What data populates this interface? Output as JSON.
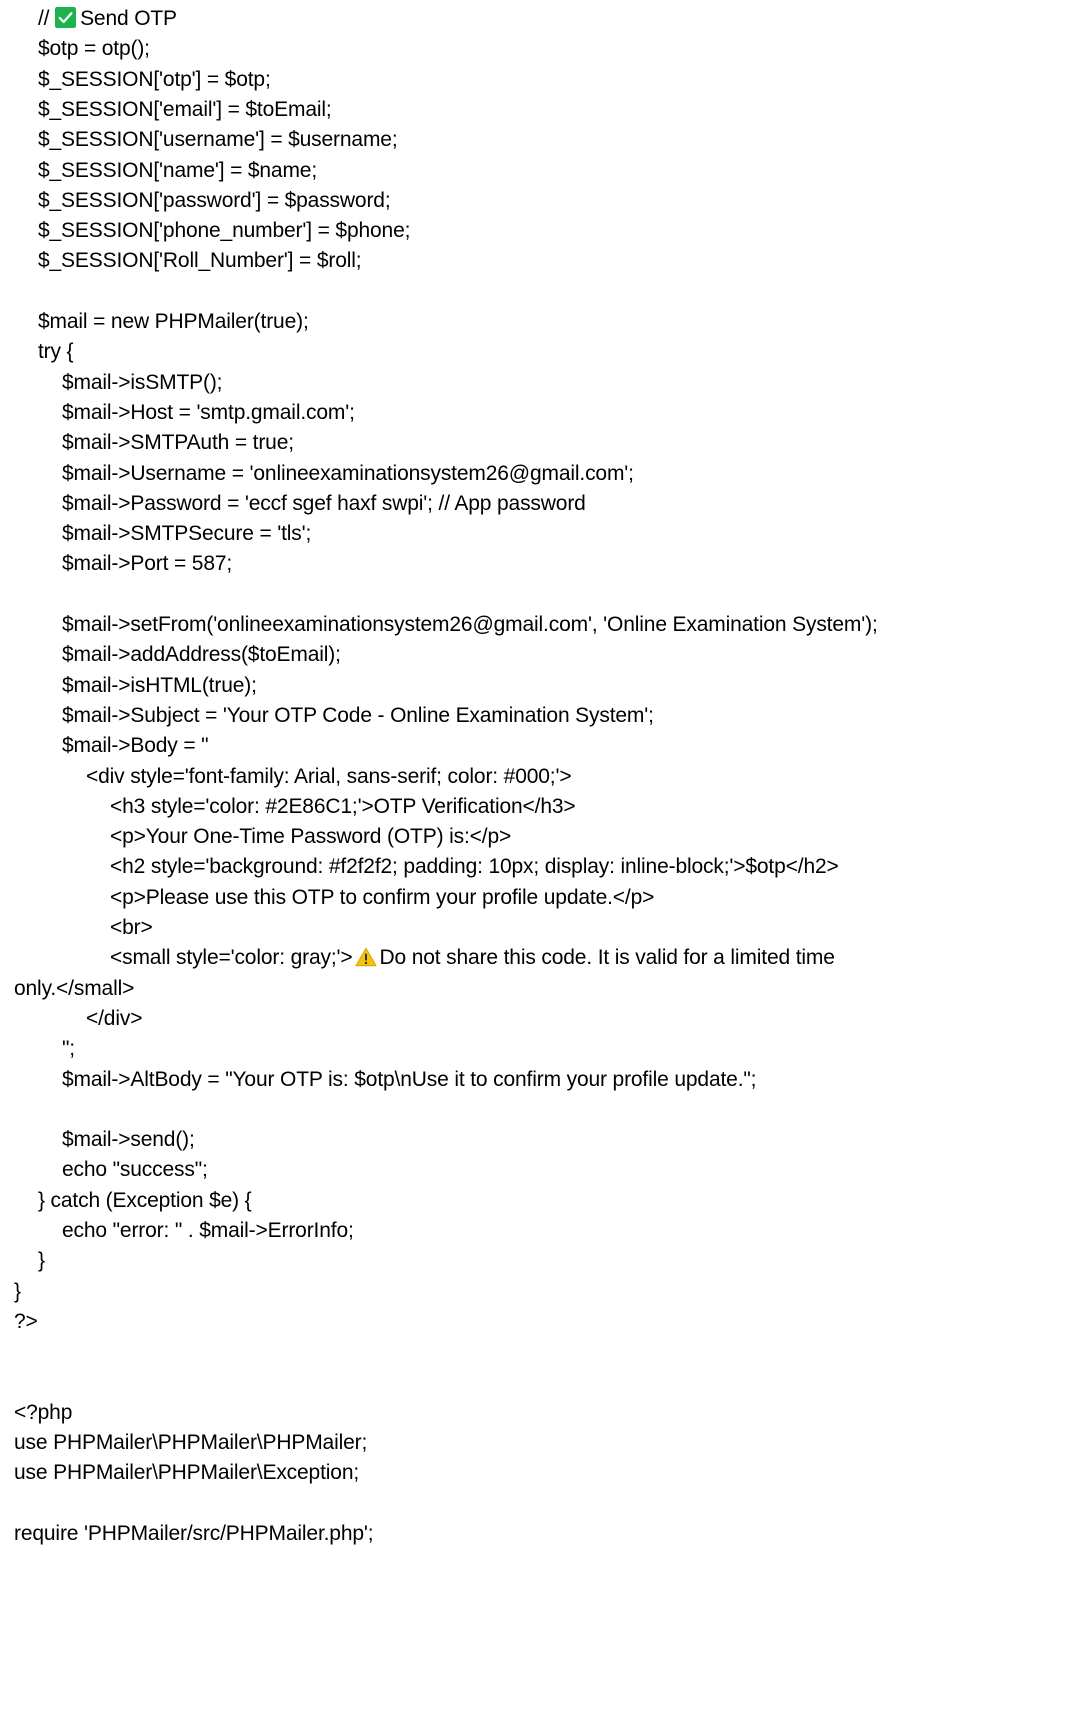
{
  "document": {
    "lines": [
      {
        "indent": 2,
        "segments": [
          {
            "t": "text",
            "v": "// "
          },
          {
            "t": "icon",
            "v": "check-icon"
          },
          {
            "t": "text",
            "v": "Send OTP"
          }
        ]
      },
      {
        "indent": 2,
        "segments": [
          {
            "t": "text",
            "v": "$otp = otp();"
          }
        ]
      },
      {
        "indent": 2,
        "segments": [
          {
            "t": "text",
            "v": "$_SESSION['otp'] = $otp;"
          }
        ]
      },
      {
        "indent": 2,
        "segments": [
          {
            "t": "text",
            "v": "$_SESSION['email'] = $toEmail;"
          }
        ]
      },
      {
        "indent": 2,
        "segments": [
          {
            "t": "text",
            "v": "$_SESSION['username'] = $username;"
          }
        ]
      },
      {
        "indent": 2,
        "segments": [
          {
            "t": "text",
            "v": "$_SESSION['name'] = $name;"
          }
        ]
      },
      {
        "indent": 2,
        "segments": [
          {
            "t": "text",
            "v": "$_SESSION['password'] = $password;"
          }
        ]
      },
      {
        "indent": 2,
        "segments": [
          {
            "t": "text",
            "v": "$_SESSION['phone_number'] = $phone;"
          }
        ]
      },
      {
        "indent": 2,
        "segments": [
          {
            "t": "text",
            "v": "$_SESSION['Roll_Number'] = $roll;"
          }
        ]
      },
      {
        "indent": 0,
        "segments": []
      },
      {
        "indent": 2,
        "segments": [
          {
            "t": "text",
            "v": "$mail = new PHPMailer(true);"
          }
        ]
      },
      {
        "indent": 2,
        "segments": [
          {
            "t": "text",
            "v": "try {"
          }
        ]
      },
      {
        "indent": 4,
        "segments": [
          {
            "t": "text",
            "v": "$mail->isSMTP();"
          }
        ]
      },
      {
        "indent": 4,
        "segments": [
          {
            "t": "text",
            "v": "$mail->Host = 'smtp.gmail.com';"
          }
        ]
      },
      {
        "indent": 4,
        "segments": [
          {
            "t": "text",
            "v": "$mail->SMTPAuth = true;"
          }
        ]
      },
      {
        "indent": 4,
        "segments": [
          {
            "t": "text",
            "v": "$mail->Username = 'onlineexaminationsystem26@gmail.com';"
          }
        ]
      },
      {
        "indent": 4,
        "segments": [
          {
            "t": "text",
            "v": "$mail->Password = 'eccf sgef haxf swpi'; // App password"
          }
        ]
      },
      {
        "indent": 4,
        "segments": [
          {
            "t": "text",
            "v": "$mail->SMTPSecure = 'tls';"
          }
        ]
      },
      {
        "indent": 4,
        "segments": [
          {
            "t": "text",
            "v": "$mail->Port = 587;"
          }
        ]
      },
      {
        "indent": 0,
        "segments": []
      },
      {
        "indent": 4,
        "segments": [
          {
            "t": "text",
            "v": "$mail->setFrom('onlineexaminationsystem26@gmail.com', 'Online Examination System');"
          }
        ]
      },
      {
        "indent": 4,
        "segments": [
          {
            "t": "text",
            "v": "$mail->addAddress($toEmail);"
          }
        ]
      },
      {
        "indent": 4,
        "segments": [
          {
            "t": "text",
            "v": "$mail->isHTML(true);"
          }
        ]
      },
      {
        "indent": 4,
        "segments": [
          {
            "t": "text",
            "v": "$mail->Subject = 'Your OTP Code - Online Examination System';"
          }
        ]
      },
      {
        "indent": 4,
        "segments": [
          {
            "t": "text",
            "v": "$mail->Body = \""
          }
        ]
      },
      {
        "indent": 6,
        "segments": [
          {
            "t": "text",
            "v": "<div style='font-family: Arial, sans-serif; color: #000;'>"
          }
        ]
      },
      {
        "indent": 8,
        "segments": [
          {
            "t": "text",
            "v": "<h3 style='color: #2E86C1;'>OTP Verification</h3>"
          }
        ]
      },
      {
        "indent": 8,
        "segments": [
          {
            "t": "text",
            "v": "<p>Your One-Time Password (OTP) is:</p>"
          }
        ]
      },
      {
        "indent": 8,
        "segments": [
          {
            "t": "text",
            "v": "<h2 style='background: #f2f2f2; padding: 10px; display: inline-block;'>$otp</h2>"
          }
        ]
      },
      {
        "indent": 8,
        "segments": [
          {
            "t": "text",
            "v": "<p>Please use this OTP to confirm your profile update.</p>"
          }
        ]
      },
      {
        "indent": 8,
        "segments": [
          {
            "t": "text",
            "v": "<br>"
          }
        ]
      },
      {
        "indent": 8,
        "segments": [
          {
            "t": "text",
            "v": "<small style='color: gray;'>"
          },
          {
            "t": "icon",
            "v": "warning-icon"
          },
          {
            "t": "text",
            "v": "Do not share this code. It is valid for a limited time"
          }
        ]
      },
      {
        "indent": 0,
        "segments": [
          {
            "t": "text",
            "v": "only.</small>"
          }
        ]
      },
      {
        "indent": 6,
        "segments": [
          {
            "t": "text",
            "v": "</div>"
          }
        ]
      },
      {
        "indent": 4,
        "segments": [
          {
            "t": "text",
            "v": "\";"
          }
        ]
      },
      {
        "indent": 4,
        "segments": [
          {
            "t": "text",
            "v": "$mail->AltBody = \"Your OTP is: $otp\\nUse it to confirm your profile update.\";"
          }
        ]
      },
      {
        "indent": 0,
        "segments": []
      },
      {
        "indent": 4,
        "segments": [
          {
            "t": "text",
            "v": "$mail->send();"
          }
        ]
      },
      {
        "indent": 4,
        "segments": [
          {
            "t": "text",
            "v": "echo \"success\";"
          }
        ]
      },
      {
        "indent": 2,
        "segments": [
          {
            "t": "text",
            "v": "} catch (Exception $e) {"
          }
        ]
      },
      {
        "indent": 4,
        "segments": [
          {
            "t": "text",
            "v": "echo \"error: \" . $mail->ErrorInfo;"
          }
        ]
      },
      {
        "indent": 2,
        "segments": [
          {
            "t": "text",
            "v": "}"
          }
        ]
      },
      {
        "indent": 0,
        "segments": [
          {
            "t": "text",
            "v": "}"
          }
        ]
      },
      {
        "indent": 0,
        "segments": [
          {
            "t": "text",
            "v": "?>"
          }
        ]
      },
      {
        "indent": 0,
        "segments": []
      },
      {
        "indent": 0,
        "segments": []
      },
      {
        "indent": 0,
        "segments": [
          {
            "t": "text",
            "v": "<?php"
          }
        ]
      },
      {
        "indent": 0,
        "segments": [
          {
            "t": "text",
            "v": "use PHPMailer\\PHPMailer\\PHPMailer;"
          }
        ]
      },
      {
        "indent": 0,
        "segments": [
          {
            "t": "text",
            "v": "use PHPMailer\\PHPMailer\\Exception;"
          }
        ]
      },
      {
        "indent": 0,
        "segments": []
      },
      {
        "indent": 0,
        "segments": [
          {
            "t": "text",
            "v": "require 'PHPMailer/src/PHPMailer.php';"
          }
        ]
      }
    ]
  },
  "colors": {
    "text": "#000000",
    "background": "#ffffff",
    "check_icon_bg": "#1bb34a",
    "warning_icon_fill": "#f6c30b",
    "warning_icon_mark": "#333333"
  }
}
